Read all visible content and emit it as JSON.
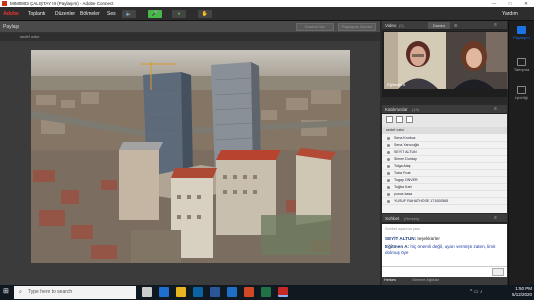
{
  "window": {
    "title": "MIM0803 ÇALIŞTAY III (Paylaşım) - Adobe Connect",
    "minimize": "—",
    "maximize": "□",
    "close": "✕"
  },
  "menubar": {
    "logo": "Adobe",
    "menus": [
      "Toplantı",
      "Düzenler",
      "Bölmeler",
      "Ses"
    ],
    "help": "Yardım"
  },
  "share_pod": {
    "title": "Paylaşı",
    "doc_name": "sedef ozkır",
    "stop_label": "Paylaşımı Durdur",
    "controls_label": "Kontrol Ver",
    "footer_name": "sedef ozkır"
  },
  "video_pod": {
    "title": "Video",
    "count": "(2)",
    "stop_button": "Durdur",
    "participant_1": "Eğitmen A"
  },
  "attendees_pod": {
    "title": "Katılımcılar",
    "count": "(14)",
    "section_label": "sedef ozkır",
    "names": [
      "Sena Konbuz",
      "Sena Yarıcıoğlu",
      "SEYİT ALTUN",
      "Simen Durday",
      "Tolga Ataş",
      "Tuba Fırat",
      "Tugay ONVER",
      "Tuğba Kart",
      "yunus kasa",
      "YUSUF RAHATHOSE 171000565"
    ]
  },
  "chat_pod": {
    "title": "Sohbet",
    "count": "(Herkes)",
    "first_line": "Sohbet ayarının yanı",
    "messages": [
      {
        "sender": "SEYİT ALTUN",
        "text": "teşekkürler",
        "sender_color": "#1a3a7a"
      },
      {
        "sender": "Eğitmen A",
        "text": "hiç önemli değil, uyarı vermiştı zaten, limit dolmuş öye",
        "sender_color": "#1a3a7a",
        "text_color": "#1a3aa0"
      }
    ],
    "tab_all": "Herkes",
    "tab_host": "Gemme Ağlıklar"
  },
  "rail": {
    "items": [
      "Paylaşım",
      "Tartışma",
      "İşbirliği"
    ]
  },
  "taskbar": {
    "search_placeholder": "Type here to search",
    "time": "1:50 PM",
    "date": "5/12/2020"
  },
  "colors": {
    "accent": "#1a73e8",
    "mic_green": "#46b946",
    "chat_blue": "#1a3aa0"
  }
}
